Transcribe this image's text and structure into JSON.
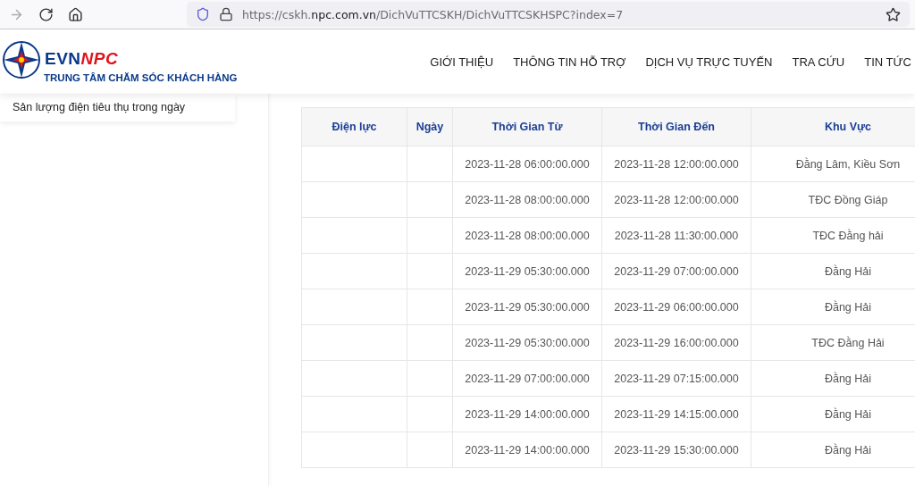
{
  "browser": {
    "url": "https://cskh.**npc.com.vn**/DichVuTTCSKH/DichVuTTCSKHSPC?index=7"
  },
  "header": {
    "logo": {
      "part1": "EVN",
      "part2": "NPC"
    },
    "subtitle": "TRUNG TÂM CHĂM SÓC KHÁCH HÀNG",
    "nav": [
      "GIỚI THIỆU",
      "THÔNG TIN HỖ TRỢ",
      "DỊCH VỤ TRỰC TUYẾN",
      "TRA CỨU",
      "TIN TỨC"
    ]
  },
  "sidebar": {
    "items": [
      "Sản lượng điện tiêu thụ trong ngày"
    ]
  },
  "table": {
    "columns": [
      "Điện lực",
      "Ngày",
      "Thời Gian Từ",
      "Thời Gian Đến",
      "Khu Vực"
    ],
    "rows": [
      [
        "",
        "",
        "2023-11-28 06:00:00.000",
        "2023-11-28 12:00:00.000",
        "Đằng Lâm, Kiều Sơn"
      ],
      [
        "",
        "",
        "2023-11-28 08:00:00.000",
        "2023-11-28 12:00:00.000",
        "TĐC Đồng Giáp"
      ],
      [
        "",
        "",
        "2023-11-28 08:00:00.000",
        "2023-11-28 11:30:00.000",
        "TĐC Đằng hải"
      ],
      [
        "",
        "",
        "2023-11-29 05:30:00.000",
        "2023-11-29 07:00:00.000",
        "Đằng Hải"
      ],
      [
        "",
        "",
        "2023-11-29 05:30:00.000",
        "2023-11-29 06:00:00.000",
        "Đằng Hải"
      ],
      [
        "",
        "",
        "2023-11-29 05:30:00.000",
        "2023-11-29 16:00:00.000",
        "TĐC Đằng Hải"
      ],
      [
        "",
        "",
        "2023-11-29 07:00:00.000",
        "2023-11-29 07:15:00.000",
        "Đằng Hải"
      ],
      [
        "",
        "",
        "2023-11-29 14:00:00.000",
        "2023-11-29 14:15:00.000",
        "Đằng Hải"
      ],
      [
        "",
        "",
        "2023-11-29 14:00:00.000",
        "2023-11-29 15:30:00.000",
        "Đằng Hải"
      ]
    ]
  }
}
